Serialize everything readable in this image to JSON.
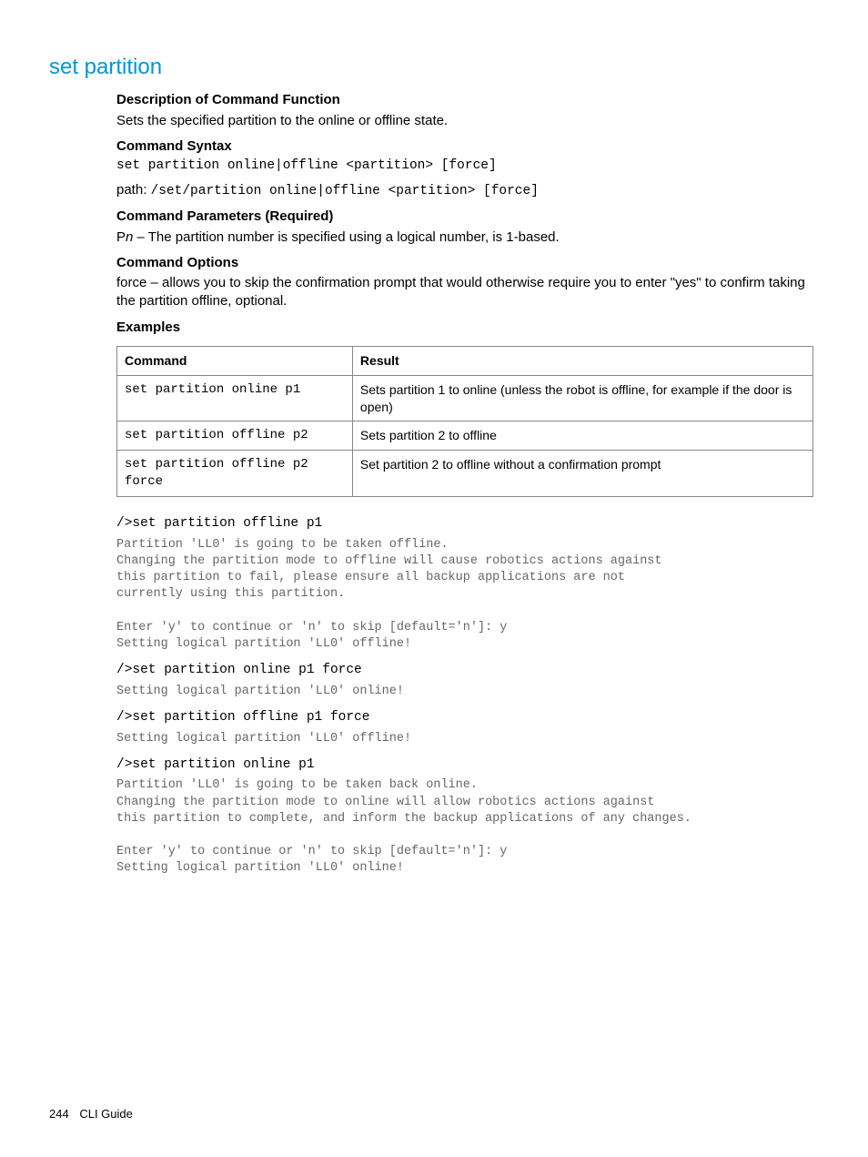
{
  "title": "set partition",
  "sections": {
    "desc_header": "Description of Command Function",
    "desc_body": "Sets the specified partition to the online or offline state.",
    "syntax_header": "Command Syntax",
    "syntax_line": "set partition online|offline <partition> [force]",
    "path_label": "path: ",
    "path_value": "/set/partition online|offline <partition> [force]",
    "params_header": "Command Parameters (Required)",
    "params_prefix": "P",
    "params_var": "n",
    "params_text": " – The partition number is specified using a logical number, is 1-based.",
    "options_header": "Command Options",
    "options_body": "force – allows you to skip the confirmation prompt that would otherwise require you to enter \"yes\" to confirm taking the partition offline, optional.",
    "examples_header": "Examples"
  },
  "table": {
    "headers": {
      "command": "Command",
      "result": "Result"
    },
    "rows": [
      {
        "command": "set partition online p1",
        "result": "Sets partition 1 to online (unless the robot is offline, for example if the door is open)"
      },
      {
        "command": "set partition offline p2",
        "result": "Sets partition 2 to offline"
      },
      {
        "command": "set partition offline p2 force",
        "result": "Set partition 2 to offline without a confirmation prompt"
      }
    ]
  },
  "examples": {
    "cmd1": "/>set partition offline p1",
    "out1": "Partition 'LL0' is going to be taken offline.\nChanging the partition mode to offline will cause robotics actions against\nthis partition to fail, please ensure all backup applications are not\ncurrently using this partition.\n\nEnter 'y' to continue or 'n' to skip [default='n']: y\nSetting logical partition 'LL0' offline!",
    "cmd2": "/>set partition online p1 force",
    "out2": "Setting logical partition 'LL0' online!",
    "cmd3": "/>set partition offline p1 force",
    "out3": "Setting logical partition 'LL0' offline!",
    "cmd4": "/>set partition online p1",
    "out4": "Partition 'LL0' is going to be taken back online.\nChanging the partition mode to online will allow robotics actions against\nthis partition to complete, and inform the backup applications of any changes.\n\nEnter 'y' to continue or 'n' to skip [default='n']: y\nSetting logical partition 'LL0' online!"
  },
  "footer": {
    "page": "244",
    "section": "CLI Guide"
  }
}
